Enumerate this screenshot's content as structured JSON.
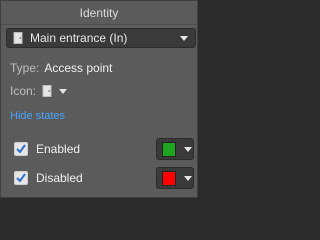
{
  "panel": {
    "title": "Identity"
  },
  "selector": {
    "value": "Main entrance (In)",
    "icon": "door-icon"
  },
  "type_row": {
    "label": "Type:",
    "value": "Access point"
  },
  "icon_row": {
    "label": "Icon:",
    "icon": "door-icon"
  },
  "link": {
    "label": "Hide states"
  },
  "states": [
    {
      "label": "Enabled",
      "checked": true,
      "color": "#1fa51f"
    },
    {
      "label": "Disabled",
      "checked": true,
      "color": "#ff0000"
    }
  ],
  "colors": {
    "background": "#5b5b5b",
    "link": "#4aa3ff",
    "checkmark": "#2f6fd1"
  }
}
